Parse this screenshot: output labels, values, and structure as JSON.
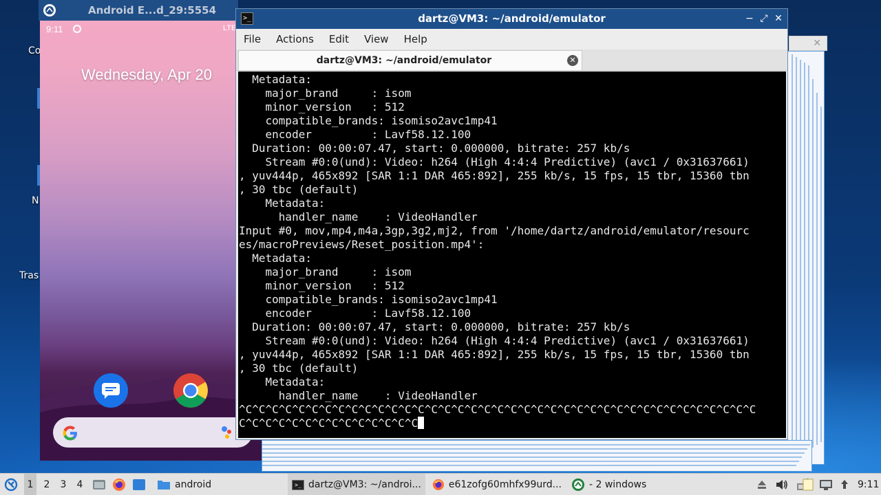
{
  "desktop": {
    "labels": [
      "Co",
      "N",
      "Tras"
    ]
  },
  "emulator": {
    "title": "Android E...d_29:5554",
    "status_time": "9:11",
    "network": "LTE",
    "date": "Wednesday, Apr 20",
    "apps": [
      "messages-icon",
      "chrome-icon"
    ],
    "search_icon": "google-g-icon"
  },
  "terminal": {
    "window_title": "dartz@VM3: ~/android/emulator",
    "menu": [
      "File",
      "Actions",
      "Edit",
      "View",
      "Help"
    ],
    "tab_label": "dartz@VM3: ~/android/emulator",
    "lines": [
      "  Metadata:",
      "    major_brand     : isom",
      "    minor_version   : 512",
      "    compatible_brands: isomiso2avc1mp41",
      "    encoder         : Lavf58.12.100",
      "  Duration: 00:00:07.47, start: 0.000000, bitrate: 257 kb/s",
      "    Stream #0:0(und): Video: h264 (High 4:4:4 Predictive) (avc1 / 0x31637661)",
      ", yuv444p, 465x892 [SAR 1:1 DAR 465:892], 255 kb/s, 15 fps, 15 tbr, 15360 tbn",
      ", 30 tbc (default)",
      "    Metadata:",
      "      handler_name    : VideoHandler",
      "Input #0, mov,mp4,m4a,3gp,3g2,mj2, from '/home/dartz/android/emulator/resourc",
      "es/macroPreviews/Reset_position.mp4':",
      "  Metadata:",
      "    major_brand     : isom",
      "    minor_version   : 512",
      "    compatible_brands: isomiso2avc1mp41",
      "    encoder         : Lavf58.12.100",
      "  Duration: 00:00:07.47, start: 0.000000, bitrate: 257 kb/s",
      "    Stream #0:0(und): Video: h264 (High 4:4:4 Predictive) (avc1 / 0x31637661)",
      ", yuv444p, 465x892 [SAR 1:1 DAR 465:892], 255 kb/s, 15 fps, 15 tbr, 15360 tbn",
      ", 30 tbc (default)",
      "    Metadata:",
      "      handler_name    : VideoHandler",
      "^C^C^C^C^C^C^C^C^C^C^C^C^C^C^C^C^C^C^C^C^C^C^C^C^C^C^C^C^C^C^C^C^C^C^C^C^C^C^C",
      "C^C^C^C^C^C^C^C^C^C^C^C^C^C"
    ],
    "colors": {
      "titlebar": "#1d4f8a",
      "terminal_bg": "#000000",
      "terminal_fg": "#e8e8e8"
    }
  },
  "taskbar": {
    "workspaces": [
      "1",
      "2",
      "3",
      "4"
    ],
    "active_workspace": "1",
    "folder_label": "android",
    "windows": [
      "dartz@VM3: ~/androi...",
      "e61zofg60mhfx99urd...",
      "- 2 windows"
    ],
    "clock": "9:11"
  }
}
